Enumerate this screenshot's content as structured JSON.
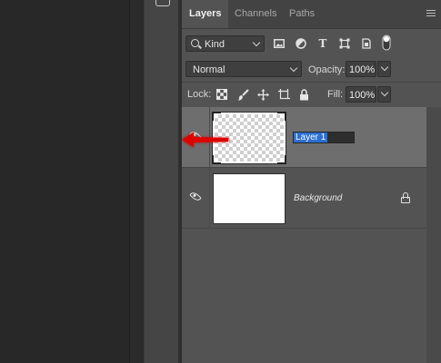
{
  "tabs": [
    {
      "label": "Layers",
      "active": true
    },
    {
      "label": "Channels",
      "active": false
    },
    {
      "label": "Paths",
      "active": false
    }
  ],
  "filter": {
    "kind_label": "Kind",
    "icons": [
      "image-filter-icon",
      "adjustment-filter-icon",
      "type-filter-icon",
      "shape-filter-icon",
      "smart-object-filter-icon",
      "filter-toggle-icon"
    ]
  },
  "blend": {
    "mode": "Normal",
    "opacity_label": "Opacity:",
    "opacity_value": "100%"
  },
  "lock": {
    "label": "Lock:",
    "icons": [
      "lock-transparent-pixels-icon",
      "lock-image-pixels-icon",
      "lock-position-icon",
      "lock-artboard-icon",
      "lock-all-icon"
    ],
    "fill_label": "Fill:",
    "fill_value": "100%"
  },
  "layers": [
    {
      "name": "Layer 1",
      "visible": true,
      "selected": true,
      "editing": true,
      "thumbnail": "transparent"
    },
    {
      "name": "Background",
      "visible": true,
      "selected": false,
      "locked": true,
      "thumbnail": "white"
    }
  ],
  "colors": {
    "panel_bg": "#535353",
    "selected_row": "#6e6e6e",
    "text_selection": "#2b6fd1",
    "annotation_arrow": "#e00000"
  }
}
